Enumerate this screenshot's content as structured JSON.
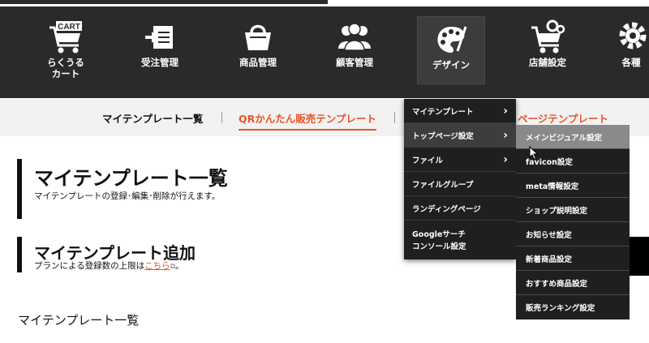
{
  "nav": {
    "items": [
      {
        "label": "らくうる\nカート",
        "icon": "cart-icon",
        "badge": "CART"
      },
      {
        "label": "受注管理",
        "icon": "order-inbox-icon"
      },
      {
        "label": "商品管理",
        "icon": "shopping-bag-icon"
      },
      {
        "label": "顧客管理",
        "icon": "customers-icon"
      },
      {
        "label": "デザイン",
        "icon": "palette-icon"
      },
      {
        "label": "店舗設定",
        "icon": "store-settings-icon"
      },
      {
        "label": "各種",
        "icon": "gear-icon"
      }
    ]
  },
  "subtabs": {
    "tab1": "マイテンプレート一覧",
    "tab2": "QRかんたん販売テンプレート",
    "tab3": "ページテンプレート"
  },
  "section1": {
    "title": "マイテンプレート一覧",
    "desc": "マイテンプレートの登録･編集･削除が行えます。"
  },
  "section2": {
    "title": "マイテンプレート追加",
    "desc_prefix": "プランによる登録数の上限は",
    "link": "こちら",
    "desc_suffix": "。"
  },
  "section3": {
    "label": "マイテンプレート一覧"
  },
  "menu": {
    "items": [
      {
        "label": "マイテンプレート",
        "has_sub": true
      },
      {
        "label": "トップページ設定",
        "has_sub": true
      },
      {
        "label": "ファイル",
        "has_sub": true
      },
      {
        "label": "ファイルグループ",
        "has_sub": false
      },
      {
        "label": "ランディングページ",
        "has_sub": false
      },
      {
        "label": "Googleサーチ\nコンソール設定",
        "has_sub": false
      }
    ]
  },
  "submenu": {
    "items": [
      "メインビジュアル設定",
      "favicon設定",
      "meta情報設定",
      "ショップ説明設定",
      "お知らせ設定",
      "新着商品設定",
      "おすすめ商品設定",
      "販売ランキング設定"
    ]
  },
  "colors": {
    "accent": "#e8542a",
    "nav_bg": "#2a2a2a",
    "menu_bg": "#1f1f1f"
  }
}
